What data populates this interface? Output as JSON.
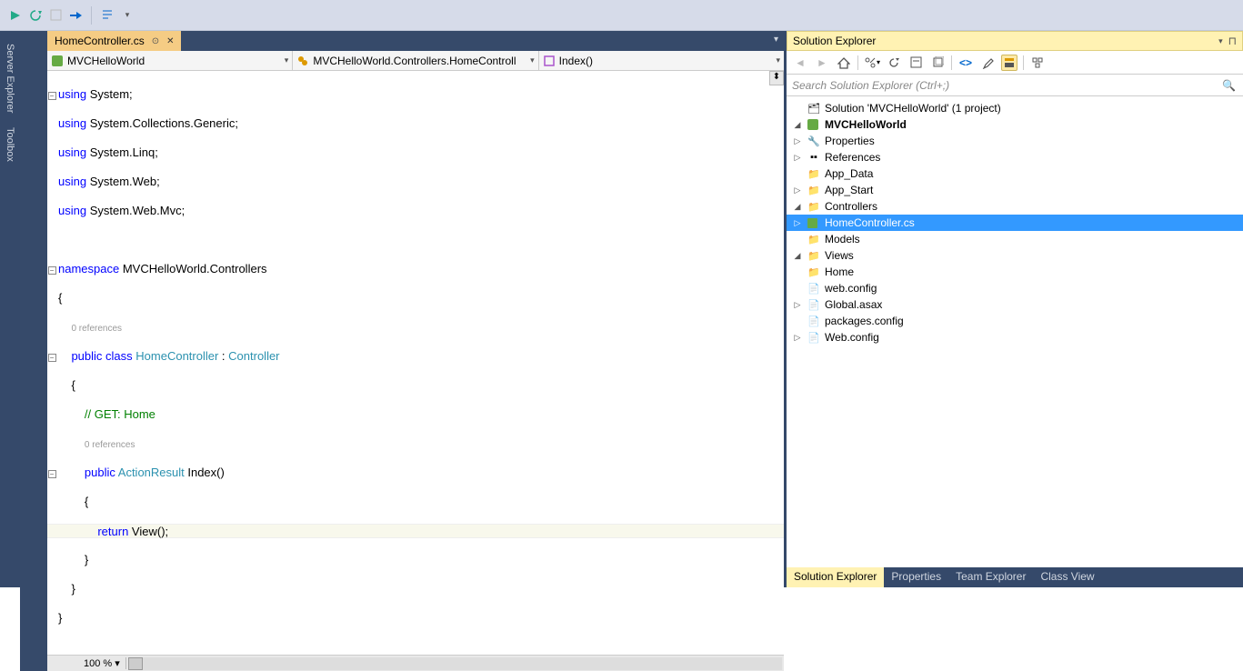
{
  "sidepanel": {
    "tabs": [
      "Server Explorer",
      "Toolbox"
    ]
  },
  "tab": {
    "name": "HomeController.cs"
  },
  "navbar": {
    "project": "MVCHelloWorld",
    "class": "MVCHelloWorld.Controllers.HomeControll",
    "member": "Index()"
  },
  "code": {
    "l1a": "using",
    "l1b": " System;",
    "l2a": "using",
    "l2b": " System.Collections.Generic;",
    "l3a": "using",
    "l3b": " System.Linq;",
    "l4a": "using",
    "l4b": " System.Web;",
    "l5a": "using",
    "l5b": " System.Web.Mvc;",
    "l7a": "namespace",
    "l7b": " MVCHelloWorld.Controllers",
    "l8": "{",
    "ref1": "0 references",
    "l9a": "    public",
    "l9b": " class",
    "l9c": " HomeController",
    "l9d": " : ",
    "l9e": "Controller",
    "l10": "    {",
    "l11": "        // GET: Home",
    "ref2": "0 references",
    "l12a": "        public",
    "l12b": " ActionResult",
    "l12c": " Index()",
    "l13": "        {",
    "l14a": "            return",
    "l14b": " View();",
    "l15": "        }",
    "l16": "    }",
    "l17": "}"
  },
  "zoom": "100 %",
  "solution_explorer": {
    "title": "Solution Explorer",
    "search_placeholder": "Search Solution Explorer (Ctrl+;)",
    "solution": "Solution 'MVCHelloWorld' (1 project)",
    "project": "MVCHelloWorld",
    "items": {
      "properties": "Properties",
      "references": "References",
      "appdata": "App_Data",
      "appstart": "App_Start",
      "controllers": "Controllers",
      "homecontroller": "HomeController.cs",
      "models": "Models",
      "views": "Views",
      "home": "Home",
      "webconfig_views": "web.config",
      "globalasax": "Global.asax",
      "packages": "packages.config",
      "webconfig": "Web.config"
    }
  },
  "bottom_tabs": [
    "Solution Explorer",
    "Properties",
    "Team Explorer",
    "Class View"
  ]
}
